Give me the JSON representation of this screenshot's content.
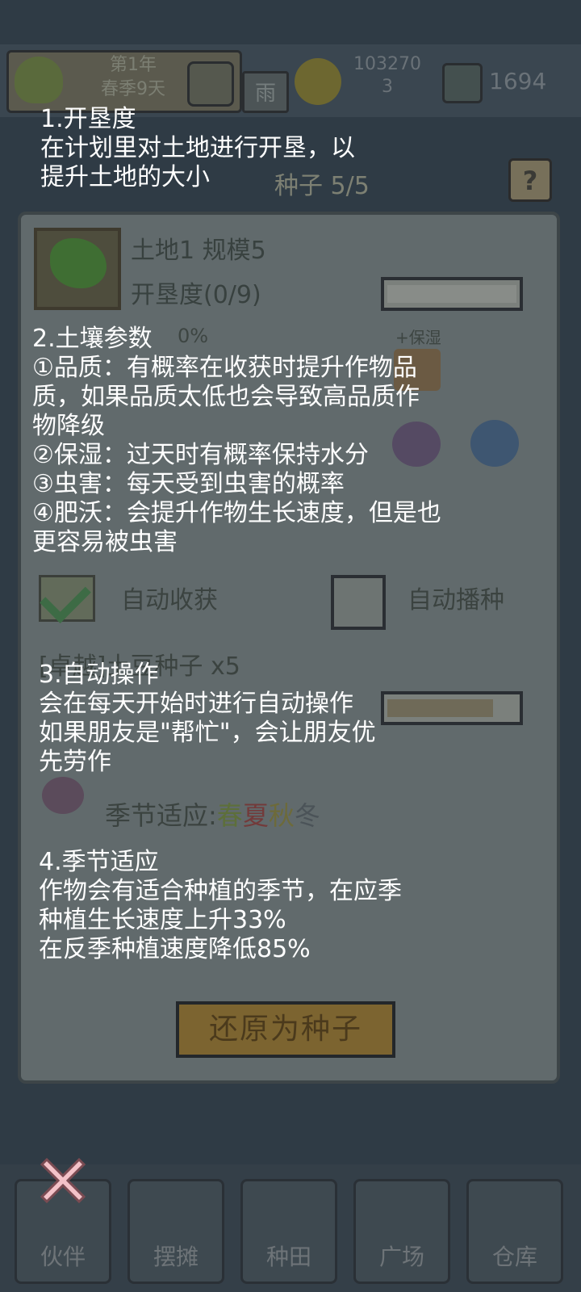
{
  "top_bar": {
    "year": "第1年",
    "season_day": "春季9天",
    "weather": "雨",
    "gold": "103270\n3",
    "gems": "1694"
  },
  "background": {
    "seed_header": "种子 5/5",
    "help": "?",
    "land_title": "土地1 规模5",
    "cultivation": "开垦度(0/9)",
    "soil_pct": "0%",
    "baoshi_tag": "+保湿",
    "auto_harvest": "自动收获",
    "auto_plant": "自动播种",
    "seed_name": "[卓越]土豆种子 x5",
    "season_label": "季节适应:",
    "seasons": [
      "春",
      "夏",
      "秋",
      "冬"
    ],
    "restore_button": "还原为种子"
  },
  "progress": {
    "cultivation_fraction": 0.0,
    "seed_growth_fraction": 0.78
  },
  "tips": {
    "tip1": "1.开垦度\n在计划里对土地进行开垦，以\n提升土地的大小",
    "tip2": "2.土壤参数\n①品质：有概率在收获时提升作物品\n质，如果品质太低也会导致高品质作\n物降级\n②保湿：过天时有概率保持水分\n③虫害：每天受到虫害的概率\n④肥沃：会提升作物生长速度，但是也\n更容易被虫害",
    "tip3": "3.自动操作\n会在每天开始时进行自动操作\n如果朋友是\"帮忙\"，会让朋友优\n先劳作",
    "tip4": "4.季节适应\n作物会有适合种植的季节，在应季\n种植生长速度上升33%\n在反季种植速度降低85%"
  },
  "nav": [
    "伙伴",
    "摆摊",
    "种田",
    "广场",
    "仓库"
  ],
  "colors": {
    "close_x": "#f3c2c8",
    "overlay_text": "#ffffff"
  }
}
